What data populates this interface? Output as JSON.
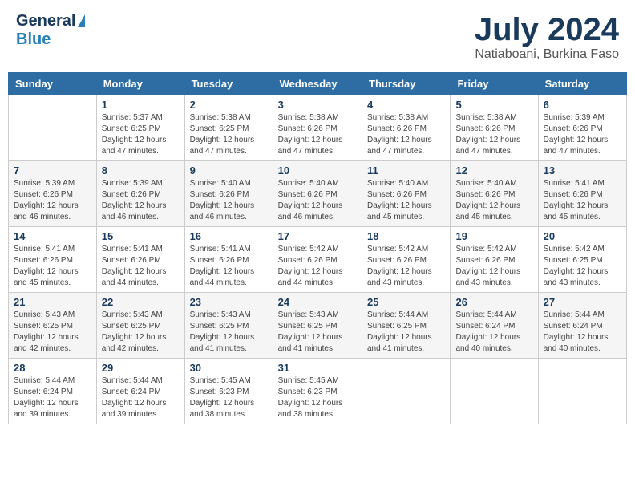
{
  "header": {
    "logo_general": "General",
    "logo_blue": "Blue",
    "month_title": "July 2024",
    "location": "Natiaboani, Burkina Faso"
  },
  "columns": [
    "Sunday",
    "Monday",
    "Tuesday",
    "Wednesday",
    "Thursday",
    "Friday",
    "Saturday"
  ],
  "weeks": [
    [
      {
        "day": "",
        "info": ""
      },
      {
        "day": "1",
        "info": "Sunrise: 5:37 AM\nSunset: 6:25 PM\nDaylight: 12 hours\nand 47 minutes."
      },
      {
        "day": "2",
        "info": "Sunrise: 5:38 AM\nSunset: 6:25 PM\nDaylight: 12 hours\nand 47 minutes."
      },
      {
        "day": "3",
        "info": "Sunrise: 5:38 AM\nSunset: 6:26 PM\nDaylight: 12 hours\nand 47 minutes."
      },
      {
        "day": "4",
        "info": "Sunrise: 5:38 AM\nSunset: 6:26 PM\nDaylight: 12 hours\nand 47 minutes."
      },
      {
        "day": "5",
        "info": "Sunrise: 5:38 AM\nSunset: 6:26 PM\nDaylight: 12 hours\nand 47 minutes."
      },
      {
        "day": "6",
        "info": "Sunrise: 5:39 AM\nSunset: 6:26 PM\nDaylight: 12 hours\nand 47 minutes."
      }
    ],
    [
      {
        "day": "7",
        "info": "Sunrise: 5:39 AM\nSunset: 6:26 PM\nDaylight: 12 hours\nand 46 minutes."
      },
      {
        "day": "8",
        "info": "Sunrise: 5:39 AM\nSunset: 6:26 PM\nDaylight: 12 hours\nand 46 minutes."
      },
      {
        "day": "9",
        "info": "Sunrise: 5:40 AM\nSunset: 6:26 PM\nDaylight: 12 hours\nand 46 minutes."
      },
      {
        "day": "10",
        "info": "Sunrise: 5:40 AM\nSunset: 6:26 PM\nDaylight: 12 hours\nand 46 minutes."
      },
      {
        "day": "11",
        "info": "Sunrise: 5:40 AM\nSunset: 6:26 PM\nDaylight: 12 hours\nand 45 minutes."
      },
      {
        "day": "12",
        "info": "Sunrise: 5:40 AM\nSunset: 6:26 PM\nDaylight: 12 hours\nand 45 minutes."
      },
      {
        "day": "13",
        "info": "Sunrise: 5:41 AM\nSunset: 6:26 PM\nDaylight: 12 hours\nand 45 minutes."
      }
    ],
    [
      {
        "day": "14",
        "info": "Sunrise: 5:41 AM\nSunset: 6:26 PM\nDaylight: 12 hours\nand 45 minutes."
      },
      {
        "day": "15",
        "info": "Sunrise: 5:41 AM\nSunset: 6:26 PM\nDaylight: 12 hours\nand 44 minutes."
      },
      {
        "day": "16",
        "info": "Sunrise: 5:41 AM\nSunset: 6:26 PM\nDaylight: 12 hours\nand 44 minutes."
      },
      {
        "day": "17",
        "info": "Sunrise: 5:42 AM\nSunset: 6:26 PM\nDaylight: 12 hours\nand 44 minutes."
      },
      {
        "day": "18",
        "info": "Sunrise: 5:42 AM\nSunset: 6:26 PM\nDaylight: 12 hours\nand 43 minutes."
      },
      {
        "day": "19",
        "info": "Sunrise: 5:42 AM\nSunset: 6:26 PM\nDaylight: 12 hours\nand 43 minutes."
      },
      {
        "day": "20",
        "info": "Sunrise: 5:42 AM\nSunset: 6:25 PM\nDaylight: 12 hours\nand 43 minutes."
      }
    ],
    [
      {
        "day": "21",
        "info": "Sunrise: 5:43 AM\nSunset: 6:25 PM\nDaylight: 12 hours\nand 42 minutes."
      },
      {
        "day": "22",
        "info": "Sunrise: 5:43 AM\nSunset: 6:25 PM\nDaylight: 12 hours\nand 42 minutes."
      },
      {
        "day": "23",
        "info": "Sunrise: 5:43 AM\nSunset: 6:25 PM\nDaylight: 12 hours\nand 41 minutes."
      },
      {
        "day": "24",
        "info": "Sunrise: 5:43 AM\nSunset: 6:25 PM\nDaylight: 12 hours\nand 41 minutes."
      },
      {
        "day": "25",
        "info": "Sunrise: 5:44 AM\nSunset: 6:25 PM\nDaylight: 12 hours\nand 41 minutes."
      },
      {
        "day": "26",
        "info": "Sunrise: 5:44 AM\nSunset: 6:24 PM\nDaylight: 12 hours\nand 40 minutes."
      },
      {
        "day": "27",
        "info": "Sunrise: 5:44 AM\nSunset: 6:24 PM\nDaylight: 12 hours\nand 40 minutes."
      }
    ],
    [
      {
        "day": "28",
        "info": "Sunrise: 5:44 AM\nSunset: 6:24 PM\nDaylight: 12 hours\nand 39 minutes."
      },
      {
        "day": "29",
        "info": "Sunrise: 5:44 AM\nSunset: 6:24 PM\nDaylight: 12 hours\nand 39 minutes."
      },
      {
        "day": "30",
        "info": "Sunrise: 5:45 AM\nSunset: 6:23 PM\nDaylight: 12 hours\nand 38 minutes."
      },
      {
        "day": "31",
        "info": "Sunrise: 5:45 AM\nSunset: 6:23 PM\nDaylight: 12 hours\nand 38 minutes."
      },
      {
        "day": "",
        "info": ""
      },
      {
        "day": "",
        "info": ""
      },
      {
        "day": "",
        "info": ""
      }
    ]
  ]
}
